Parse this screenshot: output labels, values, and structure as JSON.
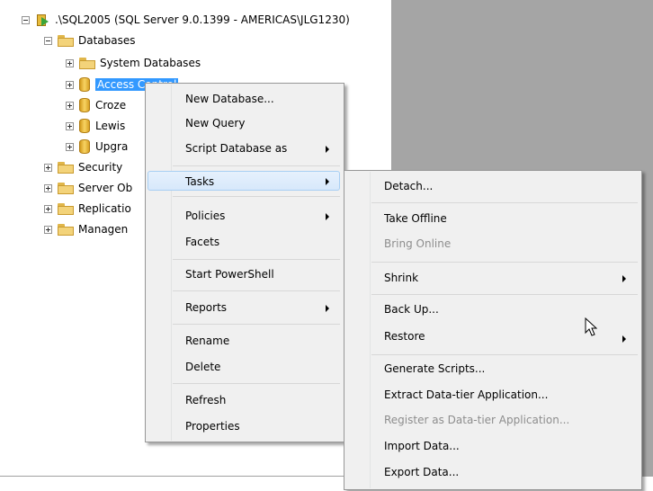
{
  "tree": {
    "server": ".\\SQL2005 (SQL Server 9.0.1399 - AMERICAS\\JLG1230)",
    "databases": "Databases",
    "system_databases": "System Databases",
    "access_control": "Access Control",
    "crozer": "Croze",
    "lewis": "Lewis",
    "upgrade": "Upgra",
    "security": "Security",
    "server_objects": "Server Ob",
    "replication": "Replicatio",
    "management": "Managen"
  },
  "context_menu": {
    "new_database": "New Database...",
    "new_query": "New Query",
    "script_database_as": "Script Database as",
    "tasks": "Tasks",
    "policies": "Policies",
    "facets": "Facets",
    "start_powershell": "Start PowerShell",
    "reports": "Reports",
    "rename": "Rename",
    "delete": "Delete",
    "refresh": "Refresh",
    "properties": "Properties"
  },
  "tasks_menu": {
    "detach": "Detach...",
    "take_offline": "Take Offline",
    "bring_online": "Bring Online",
    "shrink": "Shrink",
    "back_up": "Back Up...",
    "restore": "Restore",
    "generate_scripts": "Generate Scripts...",
    "extract_data_tier": "Extract Data-tier Application...",
    "register_data_tier": "Register as Data-tier Application...",
    "import_data": "Import Data...",
    "export_data": "Export Data..."
  }
}
